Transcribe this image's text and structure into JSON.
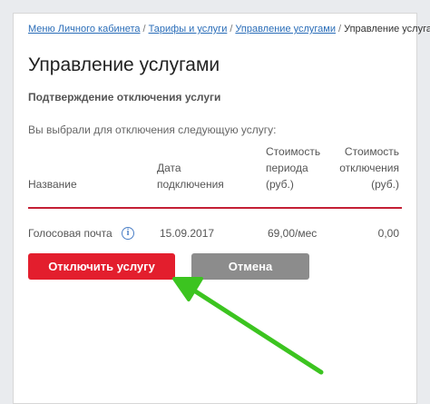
{
  "breadcrumb": {
    "items": [
      "Меню Личного кабинета",
      "Тарифы и услуги",
      "Управление услугами"
    ],
    "current": "Управление услугами",
    "separator": "/"
  },
  "page": {
    "title": "Управление услугами",
    "subtitle": "Подтверждение отключения услуги",
    "intro": "Вы выбрали для отключения следующую услугу:"
  },
  "table": {
    "headers": {
      "name": "Название",
      "date_line1": "Дата",
      "date_line2": "подключения",
      "period_line1": "Стоимость",
      "period_line2": "периода",
      "period_line3": "(руб.)",
      "off_line1": "Стоимость",
      "off_line2": "отключения",
      "off_line3": "(руб.)"
    },
    "rows": [
      {
        "name": "Голосовая почта",
        "date": "15.09.2017",
        "period_cost": "69,00/мес",
        "off_cost": "0,00"
      }
    ]
  },
  "buttons": {
    "disconnect": "Отключить услугу",
    "cancel": "Отмена"
  },
  "colors": {
    "accent_red": "#e31e2d",
    "divider_red": "#c41f35",
    "cancel_gray": "#8c8c8c",
    "link_blue": "#2a6db8",
    "arrow_green": "#3cc420"
  },
  "icons": {
    "info": "info-icon",
    "annotation": "green-arrow"
  }
}
